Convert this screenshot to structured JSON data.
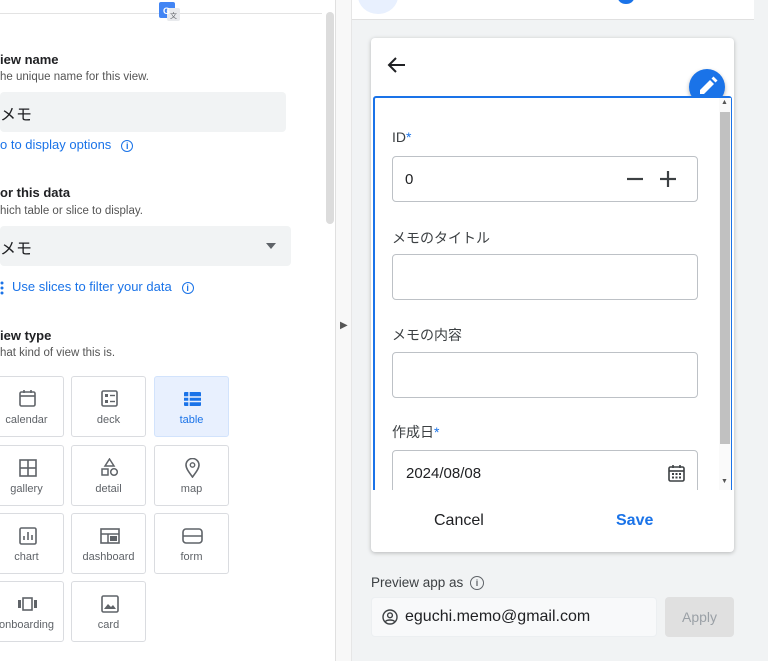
{
  "left_panel": {
    "view_name": {
      "title": "iew name",
      "subtitle": "he unique name for this view.",
      "value": "メモ",
      "link": "o to display options"
    },
    "for_this_data": {
      "title": "or this data",
      "subtitle": "hich table or slice to display.",
      "value": "メモ",
      "link": "Use slices to filter your data"
    },
    "view_type": {
      "title": "iew type",
      "subtitle": "hat kind of view this is.",
      "tiles": [
        {
          "label": "calendar",
          "icon": "calendar-icon",
          "selected": false
        },
        {
          "label": "deck",
          "icon": "deck-icon",
          "selected": false
        },
        {
          "label": "table",
          "icon": "table-icon",
          "selected": true
        },
        {
          "label": "gallery",
          "icon": "gallery-icon",
          "selected": false
        },
        {
          "label": "detail",
          "icon": "detail-icon",
          "selected": false
        },
        {
          "label": "map",
          "icon": "map-pin-icon",
          "selected": false
        },
        {
          "label": "chart",
          "icon": "chart-icon",
          "selected": false
        },
        {
          "label": "dashboard",
          "icon": "dashboard-icon",
          "selected": false
        },
        {
          "label": "form",
          "icon": "form-icon",
          "selected": false
        },
        {
          "label": "onboarding",
          "icon": "onboarding-icon",
          "selected": false
        },
        {
          "label": "card",
          "icon": "card-icon",
          "selected": false
        }
      ]
    }
  },
  "preview": {
    "form": {
      "fields": [
        {
          "label": "ID",
          "required": true,
          "value": "0"
        },
        {
          "label": "メモのタイトル",
          "required": false,
          "value": ""
        },
        {
          "label": "メモの内容",
          "required": false,
          "value": ""
        },
        {
          "label": "作成日",
          "required": true,
          "value": "2024/08/08"
        }
      ],
      "cancel_label": "Cancel",
      "save_label": "Save"
    },
    "preview_as_label": "Preview app as",
    "email": "eguchi.memo@gmail.com",
    "apply_label": "Apply"
  },
  "colors": {
    "accent": "#1a73e8",
    "selected_tile_bg": "#e8f0fe",
    "panel_bg": "#f1f3f4"
  }
}
